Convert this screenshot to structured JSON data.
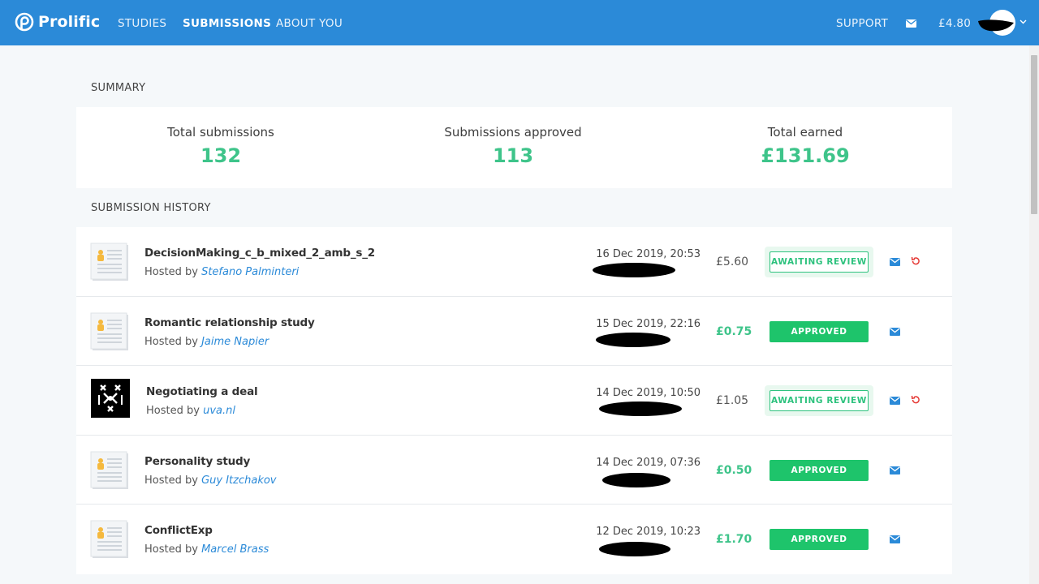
{
  "brand": {
    "name": "Prolific"
  },
  "nav": {
    "items": [
      {
        "label": "STUDIES",
        "active": false
      },
      {
        "label": "SUBMISSIONS",
        "active": true
      },
      {
        "label": "ABOUT YOU",
        "active": false
      }
    ],
    "support": "SUPPORT",
    "balance": "£4.80"
  },
  "summary": {
    "title": "SUMMARY",
    "stats": [
      {
        "label": "Total submissions",
        "value": "132"
      },
      {
        "label": "Submissions approved",
        "value": "113"
      },
      {
        "label": "Total earned",
        "value": "£131.69"
      }
    ]
  },
  "history": {
    "title": "SUBMISSION HISTORY",
    "hosted_prefix": "Hosted by",
    "rows": [
      {
        "title": "DecisionMaking_c_b_mixed_2_amb_s_2",
        "host": "Stefano Palminteri",
        "date": "16 Dec 2019, 20:53",
        "reward": "£5.60",
        "status": "AWAITING REVIEW",
        "thumb": "document-icon"
      },
      {
        "title": "Romantic relationship study",
        "host": "Jaime Napier",
        "date": "15 Dec 2019, 22:16",
        "reward": "£0.75",
        "status": "APPROVED",
        "thumb": "document-icon"
      },
      {
        "title": "Negotiating a deal",
        "host": "uva.nl",
        "date": "14 Dec 2019, 10:50",
        "reward": "£1.05",
        "status": "AWAITING REVIEW",
        "thumb": "uva-logo"
      },
      {
        "title": "Personality study",
        "host": "Guy Itzchakov",
        "date": "14 Dec 2019, 07:36",
        "reward": "£0.50",
        "status": "APPROVED",
        "thumb": "document-icon"
      },
      {
        "title": "ConflictExp",
        "host": "Marcel Brass",
        "date": "12 Dec 2019, 10:23",
        "reward": "£1.70",
        "status": "APPROVED",
        "thumb": "document-icon"
      }
    ]
  },
  "colors": {
    "header": "#2b8ad8",
    "accent_green": "#3ec48a",
    "approved_badge": "#1ec46b",
    "undo_red": "#e53935"
  }
}
